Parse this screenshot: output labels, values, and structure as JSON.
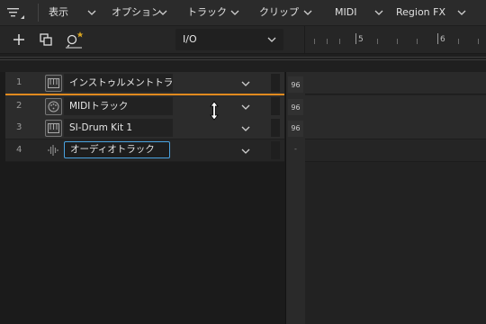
{
  "menu": {
    "items": [
      {
        "label": "表示"
      },
      {
        "label": "オプション"
      },
      {
        "label": "トラック"
      },
      {
        "label": "クリップ"
      },
      {
        "label": "MIDI"
      },
      {
        "label": "Region FX"
      }
    ]
  },
  "toolbar": {
    "io_label": "I/O"
  },
  "ruler": {
    "marks": [
      "5",
      "6"
    ]
  },
  "tracks": [
    {
      "number": "1",
      "name": "インストゥルメントトラック",
      "icon": "instrument-icon",
      "meter": "96"
    },
    {
      "number": "2",
      "name": "MIDIトラック",
      "icon": "midi-icon",
      "meter": "96"
    },
    {
      "number": "3",
      "name": "SI-Drum Kit 1",
      "icon": "instrument-icon",
      "meter": "96"
    },
    {
      "number": "4",
      "name": "オーディオトラック",
      "icon": "audio-icon",
      "meter": "-"
    }
  ],
  "colors": {
    "accent_orange": "#e08a1f",
    "edit_focus_blue": "#4aa3e0"
  }
}
